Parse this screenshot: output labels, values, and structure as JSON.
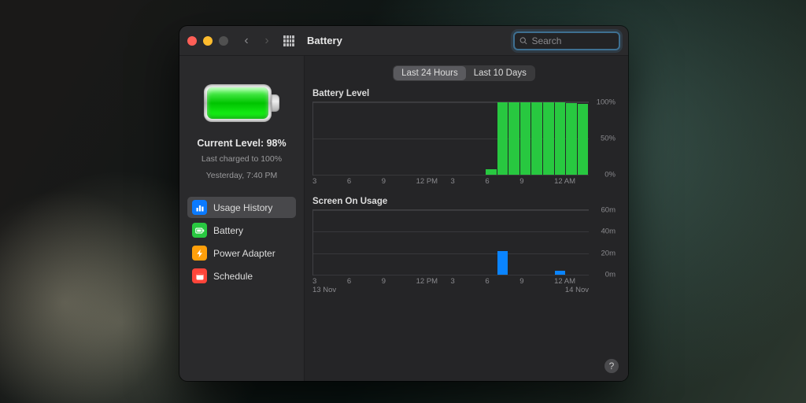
{
  "window": {
    "title": "Battery"
  },
  "search": {
    "placeholder": "Search"
  },
  "battery_status": {
    "level_line": "Current Level: 98%",
    "charged_line": "Last charged to 100%",
    "time_line": "Yesterday, 7:40 PM"
  },
  "sidebar": {
    "items": [
      {
        "label": "Usage History",
        "selected": true,
        "icon": "chart-bar-icon",
        "color": "#0a7aff"
      },
      {
        "label": "Battery",
        "selected": false,
        "icon": "battery-icon",
        "color": "#28c840"
      },
      {
        "label": "Power Adapter",
        "selected": false,
        "icon": "bolt-icon",
        "color": "#ff9f0a"
      },
      {
        "label": "Schedule",
        "selected": false,
        "icon": "calendar-icon",
        "color": "#ff453a"
      }
    ]
  },
  "segmented": {
    "options": [
      "Last 24 Hours",
      "Last 10 Days"
    ],
    "active": 0
  },
  "sections": {
    "battery_level_title": "Battery Level",
    "screen_on_title": "Screen On Usage"
  },
  "chart_data": [
    {
      "type": "bar",
      "title": "Battery Level",
      "ylabel": "%",
      "ylim": [
        0,
        100
      ],
      "yticks": [
        0,
        50,
        100
      ],
      "xticks": [
        "3",
        "6",
        "9",
        "12 PM",
        "3",
        "6",
        "9",
        "12 AM"
      ],
      "categories_hours": [
        3,
        4,
        5,
        6,
        7,
        8,
        9,
        10,
        11,
        12,
        13,
        14,
        15,
        16,
        17,
        18,
        19,
        20,
        21,
        22,
        23,
        0,
        1,
        2
      ],
      "series": [
        {
          "name": "Battery Level",
          "color": "#28c840",
          "values": [
            null,
            null,
            null,
            null,
            null,
            null,
            null,
            null,
            null,
            null,
            null,
            null,
            null,
            null,
            null,
            8,
            100,
            100,
            100,
            100,
            100,
            100,
            99,
            98
          ]
        }
      ]
    },
    {
      "type": "bar",
      "title": "Screen On Usage",
      "ylabel": "minutes",
      "ylim": [
        0,
        60
      ],
      "yticks": [
        0,
        20,
        40,
        60
      ],
      "xticks": [
        "3",
        "6",
        "9",
        "12 PM",
        "3",
        "6",
        "9",
        "12 AM"
      ],
      "date_labels": {
        "left": "13 Nov",
        "right": "14 Nov"
      },
      "categories_hours": [
        3,
        4,
        5,
        6,
        7,
        8,
        9,
        10,
        11,
        12,
        13,
        14,
        15,
        16,
        17,
        18,
        19,
        20,
        21,
        22,
        23,
        0,
        1,
        2
      ],
      "series": [
        {
          "name": "Screen On",
          "color": "#0a84ff",
          "values": [
            0,
            0,
            0,
            0,
            0,
            0,
            0,
            0,
            0,
            0,
            0,
            0,
            0,
            0,
            0,
            0,
            22,
            0,
            0,
            0,
            0,
            4,
            0,
            0
          ]
        }
      ]
    }
  ],
  "help": {
    "label": "?"
  }
}
